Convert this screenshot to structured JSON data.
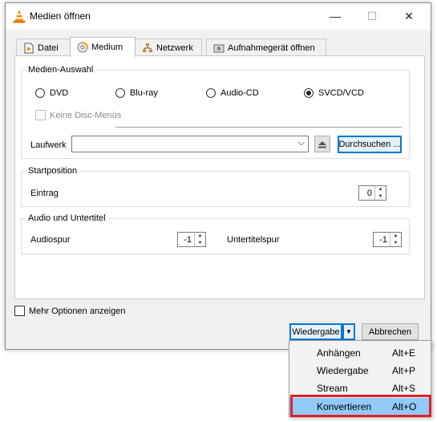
{
  "window": {
    "title": "Medien öffnen"
  },
  "window_controls": {
    "minimize": "—",
    "maximize": "☐",
    "close": "✕"
  },
  "tabs": [
    {
      "label": "Datei",
      "icon": "file-icon"
    },
    {
      "label": "Medium",
      "icon": "disc-icon",
      "active": true
    },
    {
      "label": "Netzwerk",
      "icon": "network-icon"
    },
    {
      "label": "Aufnahmegerät öffnen",
      "icon": "capture-device-icon"
    }
  ],
  "media_selection": {
    "title": "Medien-Auswahl",
    "options": [
      {
        "label": "DVD",
        "checked": false
      },
      {
        "label": "Blu-ray",
        "checked": false
      },
      {
        "label": "Audio-CD",
        "checked": false
      },
      {
        "label": "SVCD/VCD",
        "checked": true
      }
    ],
    "no_disc_menus": "Keine Disc-Menüs",
    "drive_label": "Laufwerk",
    "drive_value": "",
    "browse_button": "Durchsuchen ..."
  },
  "start_position": {
    "title": "Startposition",
    "entry_label": "Eintrag",
    "entry_value": "0"
  },
  "audio_subtitles": {
    "title": "Audio und Untertitel",
    "audio_label": "Audiospur",
    "audio_value": "-1",
    "subtitle_label": "Untertitelspur",
    "subtitle_value": "-1"
  },
  "more_options": "Mehr Optionen anzeigen",
  "footer": {
    "play_button": "Wiedergabe",
    "cancel_button": "Abbrechen"
  },
  "menu": {
    "items": [
      {
        "label": "Anhängen",
        "shortcut": "Alt+E"
      },
      {
        "label": "Wiedergabe",
        "shortcut": "Alt+P"
      },
      {
        "label": "Stream",
        "shortcut": "Alt+S"
      },
      {
        "label": "Konvertieren",
        "shortcut": "Alt+O",
        "highlighted": true
      }
    ]
  },
  "colors": {
    "accent": "#0078d7",
    "menu_highlight": "#91c9f7",
    "annotation_red": "#e0202a",
    "vlc_orange": "#f08c00"
  }
}
